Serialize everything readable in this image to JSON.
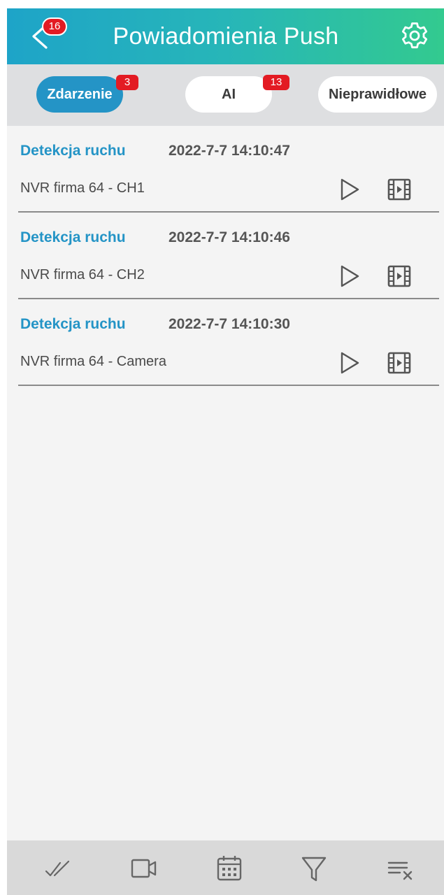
{
  "header": {
    "title": "Powiadomienia Push",
    "back_badge": "16",
    "back_icon": "chevron-left-icon",
    "settings_icon": "gear-icon"
  },
  "tabs": [
    {
      "label": "Zdarzenie",
      "badge": "3",
      "active": true
    },
    {
      "label": "AI",
      "badge": "13",
      "active": false
    },
    {
      "label": "Nieprawidłowe",
      "badge": "",
      "active": false
    }
  ],
  "notifications": [
    {
      "type": "Detekcja ruchu",
      "time": "2022-7-7 14:10:47",
      "source": "NVR firma 64 - CH1"
    },
    {
      "type": "Detekcja ruchu",
      "time": "2022-7-7 14:10:46",
      "source": "NVR firma 64 - CH2"
    },
    {
      "type": "Detekcja ruchu",
      "time": "2022-7-7 14:10:30",
      "source": "NVR firma 64 - Camera"
    }
  ],
  "toolbar": {
    "icons": [
      "mark-all-read-icon",
      "video-camera-icon",
      "calendar-icon",
      "filter-icon",
      "clear-list-icon"
    ]
  },
  "colors": {
    "accent": "#2494c6",
    "header_start": "#1ea4c8",
    "header_end": "#33ca8f",
    "badge": "#e31b23"
  }
}
